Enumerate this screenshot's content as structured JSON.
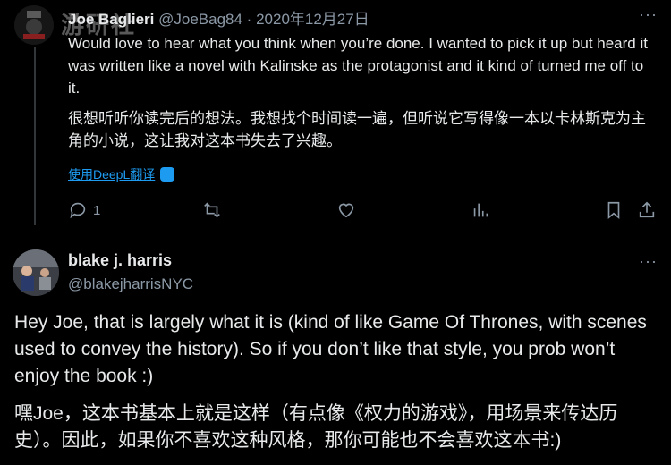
{
  "reply": {
    "author_name": "Joe Baglieri",
    "author_handle": "@JoeBag84",
    "separator": "·",
    "date": "2020年12月27日",
    "text_en": "Would love to hear what you think when you’re done. I wanted to pick it up but heard it was written like a novel with Kalinske as the protagonist and it kind of turned me off to it.",
    "text_zh": "很想听听你读完后的想法。我想找个时间读一遍，但听说它写得像一本以卡林斯克为主角的小说，这让我对这本书失去了兴趣。",
    "translate_label": "使用DeepL翻译",
    "reply_count": "1",
    "more_label": "···"
  },
  "main": {
    "author_name": "blake j. harris",
    "author_handle": "@blakejharrisNYC",
    "text_en": "Hey Joe, that is largely what it is (kind of like Game Of Thrones, with scenes used to convey the history). So if you don’t like that style, you prob won’t enjoy the book :)",
    "text_zh": "嘿Joe，这本书基本上就是这样（有点像《权力的游戏》，用场景来传达历史）。因此，如果你不喜欢这种风格，那你可能也不会喜欢这本书:)",
    "more_label": "···"
  },
  "watermark": "游研社",
  "icons": [
    "reply-icon",
    "retweet-icon",
    "like-icon",
    "views-icon",
    "bookmark-icon",
    "share-icon",
    "deepl-icon"
  ]
}
